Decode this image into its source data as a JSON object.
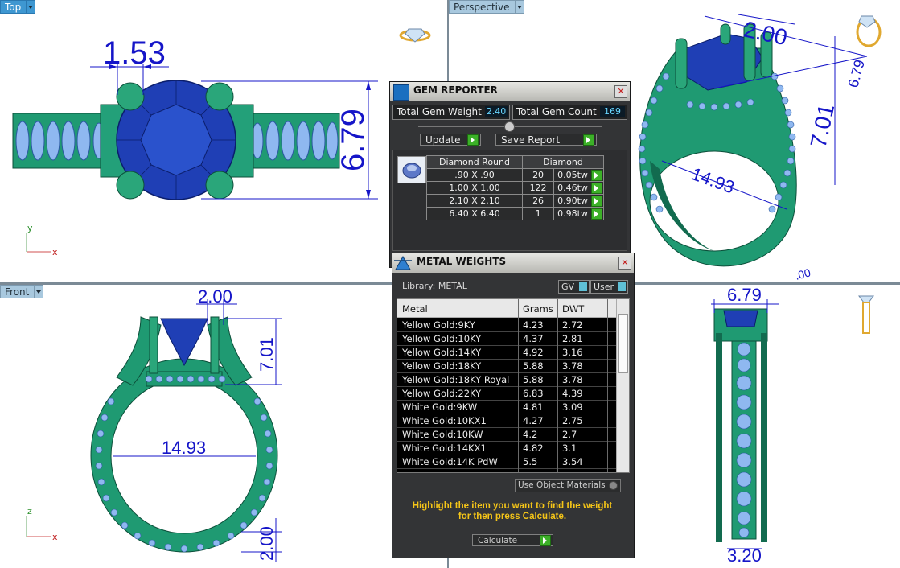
{
  "viewports": {
    "top": {
      "label": "Top",
      "active": true,
      "dims": [
        "1.53",
        "6.79"
      ],
      "axis": [
        "y",
        "x"
      ]
    },
    "perspective": {
      "label": "Perspective",
      "dims": [
        "2.00",
        "6.79",
        "7.01",
        "14.93",
        ".00"
      ]
    },
    "front": {
      "label": "Front",
      "dims": [
        "2.00",
        "7.01",
        "14.93",
        "2.00"
      ],
      "axis": [
        "z",
        "x"
      ]
    },
    "right": {
      "dims": [
        "6.79",
        "3.20"
      ]
    }
  },
  "gem_reporter": {
    "title": "GEM REPORTER",
    "total_weight_label": "Total Gem Weight",
    "total_weight": "2.40",
    "total_count_label": "Total Gem Count",
    "total_count": "169",
    "update_label": "Update",
    "save_label": "Save Report",
    "headers": [
      "Diamond Round",
      "Diamond"
    ],
    "rows": [
      {
        "size": ".90 X .90",
        "count": "20",
        "tw": "0.05tw"
      },
      {
        "size": "1.00 X 1.00",
        "count": "122",
        "tw": "0.46tw"
      },
      {
        "size": "2.10 X 2.10",
        "count": "26",
        "tw": "0.90tw"
      },
      {
        "size": "6.40 X 6.40",
        "count": "1",
        "tw": "0.98tw"
      }
    ]
  },
  "metal_weights": {
    "title": "METAL WEIGHTS",
    "library": "Library: METAL",
    "gv": "GV",
    "user": "User",
    "headers": {
      "metal": "Metal",
      "grams": "Grams",
      "dwt": "DWT"
    },
    "rows": [
      {
        "metal": "Yellow Gold:9KY",
        "grams": "4.23",
        "dwt": "2.72"
      },
      {
        "metal": "Yellow Gold:10KY",
        "grams": "4.37",
        "dwt": "2.81"
      },
      {
        "metal": "Yellow Gold:14KY",
        "grams": "4.92",
        "dwt": "3.16"
      },
      {
        "metal": "Yellow Gold:18KY",
        "grams": "5.88",
        "dwt": "3.78"
      },
      {
        "metal": "Yellow Gold:18KY Royal",
        "grams": "5.88",
        "dwt": "3.78"
      },
      {
        "metal": "Yellow Gold:22KY",
        "grams": "6.83",
        "dwt": "4.39"
      },
      {
        "metal": "White Gold:9KW",
        "grams": "4.81",
        "dwt": "3.09"
      },
      {
        "metal": "White Gold:10KX1",
        "grams": "4.27",
        "dwt": "2.75"
      },
      {
        "metal": "White Gold:10KW",
        "grams": "4.2",
        "dwt": "2.7"
      },
      {
        "metal": "White Gold:14KX1",
        "grams": "4.82",
        "dwt": "3.1"
      },
      {
        "metal": "White Gold:14K PdW",
        "grams": "5.5",
        "dwt": "3.54"
      }
    ],
    "use_object_materials": "Use Object Materials",
    "hint_line1": "Highlight the item you want to find the weight",
    "hint_line2": "for then press Calculate.",
    "calculate": "Calculate"
  },
  "colors": {
    "metal": "#1f9a72",
    "metal_dark": "#126b4f",
    "gem": "#1f3fb5",
    "accent_gem": "#8fb8f0",
    "dimension": "#1515c8"
  }
}
